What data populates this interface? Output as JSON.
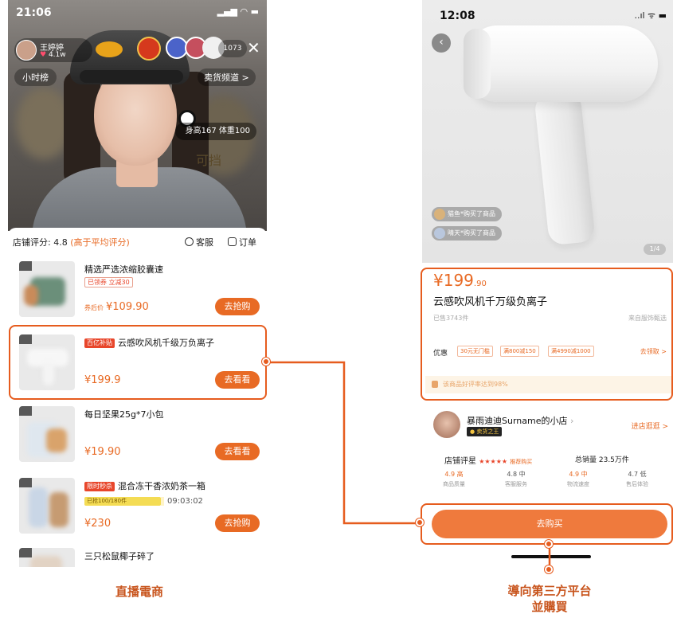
{
  "left_phone": {
    "status_time": "21:06",
    "host": {
      "name": "王婷婷",
      "fans": "4.1w"
    },
    "viewer_count": "1073",
    "close_icon": "✕",
    "hour_rank": "小时榜",
    "sale_channel": "卖货频道 >",
    "host_info": "身高167 体重100",
    "bg_text": "可挡",
    "shop_header": {
      "rating_label": "店铺评分: 4.8",
      "rating_note": "(高于平均评分)",
      "service": "客服",
      "orders": "订单"
    },
    "products": [
      {
        "title": "精选严选浓缩胶囊速",
        "tag": "",
        "coupon": "已领券 立减30",
        "price_label": "券后价",
        "price": "¥109.90",
        "button": "去抢购"
      },
      {
        "title": "云感吹风机千级万负离子",
        "tag": "百亿补贴",
        "coupon": "",
        "price_label": "",
        "price": "¥199.9",
        "button": "去看看"
      },
      {
        "title": "每日坚果25g*7小包",
        "tag": "",
        "coupon": "",
        "price_label": "",
        "price": "¥19.90",
        "button": "去看看"
      },
      {
        "title": "混合冻干香浓奶茶一箱",
        "tag": "限时秒杀",
        "coupon": "",
        "progress": "已抢100/180件",
        "timer": "09:03:02",
        "price_label": "",
        "price": "¥230",
        "button": "去抢购"
      },
      {
        "title": "三只松鼠椰子碎了",
        "tag": "",
        "coupon": "",
        "price_label": "",
        "price": "",
        "button": ""
      }
    ]
  },
  "right_phone": {
    "status_time": "12:08",
    "status_icons": "..ıl ᯤ ▬",
    "back_icon": "‹",
    "buyers": [
      "猫鱼*购买了商品",
      "晴天*购买了商品"
    ],
    "page_indicator": "1/4",
    "price_main": "¥199",
    "price_decimal": ".90",
    "title": "云感吹风机千万级负离子",
    "sold": "已售3743件",
    "origin": "来自服饰甄选",
    "discount_label": "优惠",
    "coupons": [
      "30元无门槛",
      "满800减150",
      "满4990减1000"
    ],
    "get_coupons": "去领取 >",
    "review_text": "该商品好评率达到98%",
    "store": {
      "name": "暴雨迪迪Surname的小店",
      "arrow": "›",
      "badge": "● 卖货之王",
      "visit": "进店逛逛 >",
      "rating_label": "店铺评星",
      "stars": "★★★★★",
      "recommend": "推荐购买",
      "sales": "总销量 23.5万件",
      "metrics": [
        {
          "value": "4.9 高",
          "label": "商品质量",
          "color": "#e86a24"
        },
        {
          "value": "4.8 中",
          "label": "客服服务",
          "color": "#555555"
        },
        {
          "value": "4.9 中",
          "label": "物流速度",
          "color": "#e86a24"
        },
        {
          "value": "4.7 低",
          "label": "售后体验",
          "color": "#555555"
        }
      ]
    },
    "buy_button": "去购买"
  },
  "captions": {
    "left": "直播電商",
    "right_line1": "導向第三方平台",
    "right_line2": "並購買"
  },
  "colors": {
    "accent": "#e65c1e",
    "price": "#e86a24"
  }
}
